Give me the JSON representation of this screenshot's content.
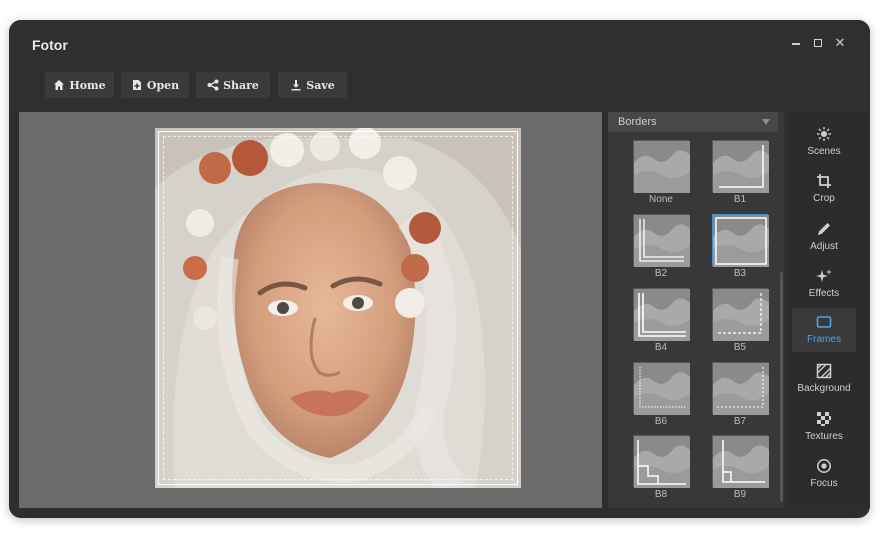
{
  "window": {
    "title": "Fotor"
  },
  "toolbar": {
    "home_label": "Home",
    "open_label": "Open",
    "share_label": "Share",
    "save_label": "Save"
  },
  "borders": {
    "dropdown_label": "Borders",
    "items": [
      {
        "label": "None"
      },
      {
        "label": "B1"
      },
      {
        "label": "B2"
      },
      {
        "label": "B3",
        "selected": true
      },
      {
        "label": "B4"
      },
      {
        "label": "B5"
      },
      {
        "label": "B6"
      },
      {
        "label": "B7"
      },
      {
        "label": "B8"
      },
      {
        "label": "B9"
      }
    ]
  },
  "sidebar": {
    "items": [
      {
        "label": "Scenes",
        "icon": "sun-icon"
      },
      {
        "label": "Crop",
        "icon": "crop-icon"
      },
      {
        "label": "Adjust",
        "icon": "pencil-icon"
      },
      {
        "label": "Effects",
        "icon": "sparkle-icon"
      },
      {
        "label": "Frames",
        "icon": "frame-icon",
        "active": true
      },
      {
        "label": "Background",
        "icon": "background-icon"
      },
      {
        "label": "Textures",
        "icon": "texture-icon"
      },
      {
        "label": "Focus",
        "icon": "focus-icon"
      }
    ]
  },
  "colors": {
    "accent": "#3a8fd8",
    "active_text": "#4da3f0",
    "window_bg": "#2e2e2e",
    "canvas_bg": "#6b6b6b"
  }
}
